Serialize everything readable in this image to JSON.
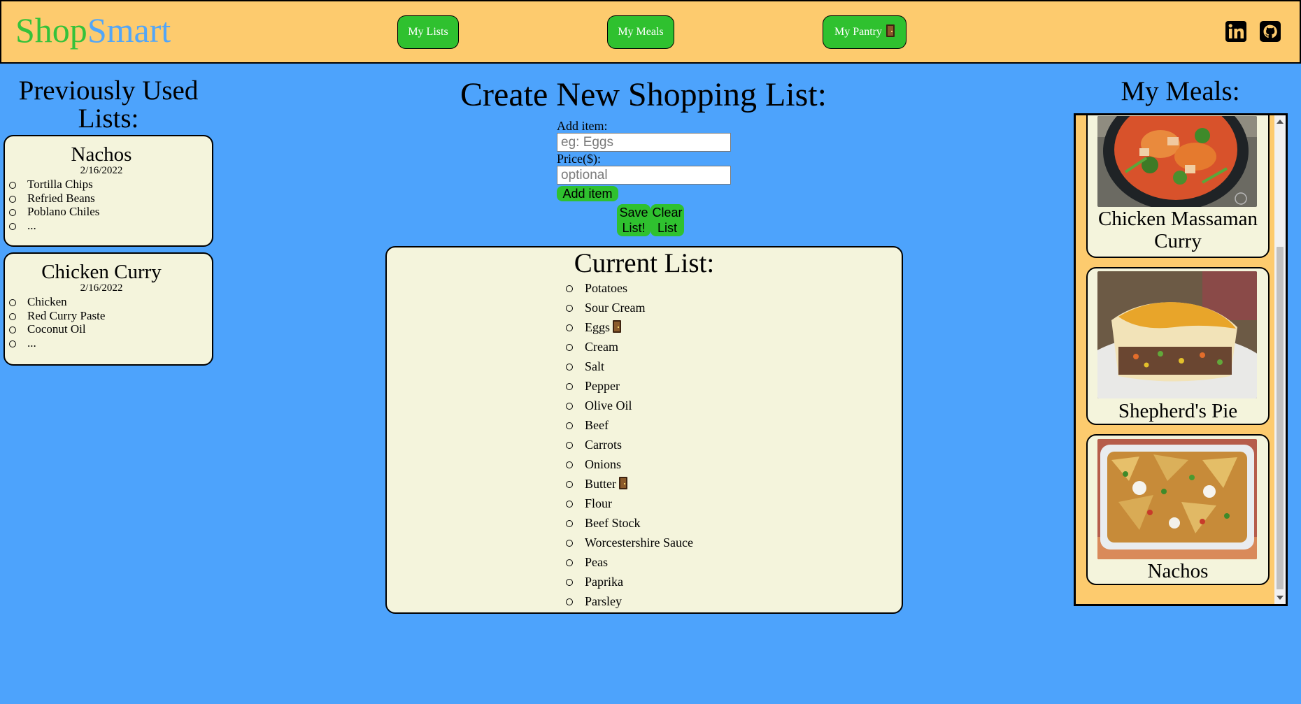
{
  "header": {
    "brand_part1": "Shop",
    "brand_part2": "Smart",
    "nav": {
      "my_lists": "My Lists",
      "my_meals": "My Meals",
      "my_pantry": "My Pantry"
    },
    "social": [
      "linkedin-icon",
      "github-icon"
    ]
  },
  "left": {
    "title": "Previously Used Lists:",
    "lists": [
      {
        "name": "Nachos",
        "date": "2/16/2022",
        "items": [
          "Tortilla Chips",
          "Refried Beans",
          "Poblano Chiles",
          "..."
        ]
      },
      {
        "name": "Chicken Curry",
        "date": "2/16/2022",
        "items": [
          "Chicken",
          "Red Curry Paste",
          "Coconut Oil",
          "..."
        ]
      }
    ]
  },
  "center": {
    "title": "Create New Shopping List:",
    "add_item_label": "Add item:",
    "add_item_placeholder": "eg: Eggs",
    "price_label": "Price($):",
    "price_placeholder": "optional",
    "add_button": "Add item",
    "save_button": "Save List!",
    "clear_button": "Clear List",
    "current_title": "Current List:",
    "items": [
      {
        "name": "Potatoes",
        "pantry": false
      },
      {
        "name": "Sour Cream",
        "pantry": false
      },
      {
        "name": "Eggs",
        "pantry": true
      },
      {
        "name": "Cream",
        "pantry": false
      },
      {
        "name": "Salt",
        "pantry": false
      },
      {
        "name": "Pepper",
        "pantry": false
      },
      {
        "name": "Olive Oil",
        "pantry": false
      },
      {
        "name": "Beef",
        "pantry": false
      },
      {
        "name": "Carrots",
        "pantry": false
      },
      {
        "name": "Onions",
        "pantry": false
      },
      {
        "name": "Butter",
        "pantry": true
      },
      {
        "name": "Flour",
        "pantry": false
      },
      {
        "name": "Beef Stock",
        "pantry": false
      },
      {
        "name": "Worcestershire Sauce",
        "pantry": false
      },
      {
        "name": "Peas",
        "pantry": false
      },
      {
        "name": "Paprika",
        "pantry": false
      },
      {
        "name": "Parsley",
        "pantry": false
      }
    ]
  },
  "right": {
    "title": "My Meals:",
    "meals": [
      {
        "name": "Chicken Massaman Curry"
      },
      {
        "name": "Shepherd's Pie"
      },
      {
        "name": "Nachos"
      }
    ]
  },
  "colors": {
    "page_bg": "#4da3fc",
    "header_bg": "#fdcb6e",
    "button_green": "#2fc12f",
    "card_bg": "#f4f4dc"
  }
}
